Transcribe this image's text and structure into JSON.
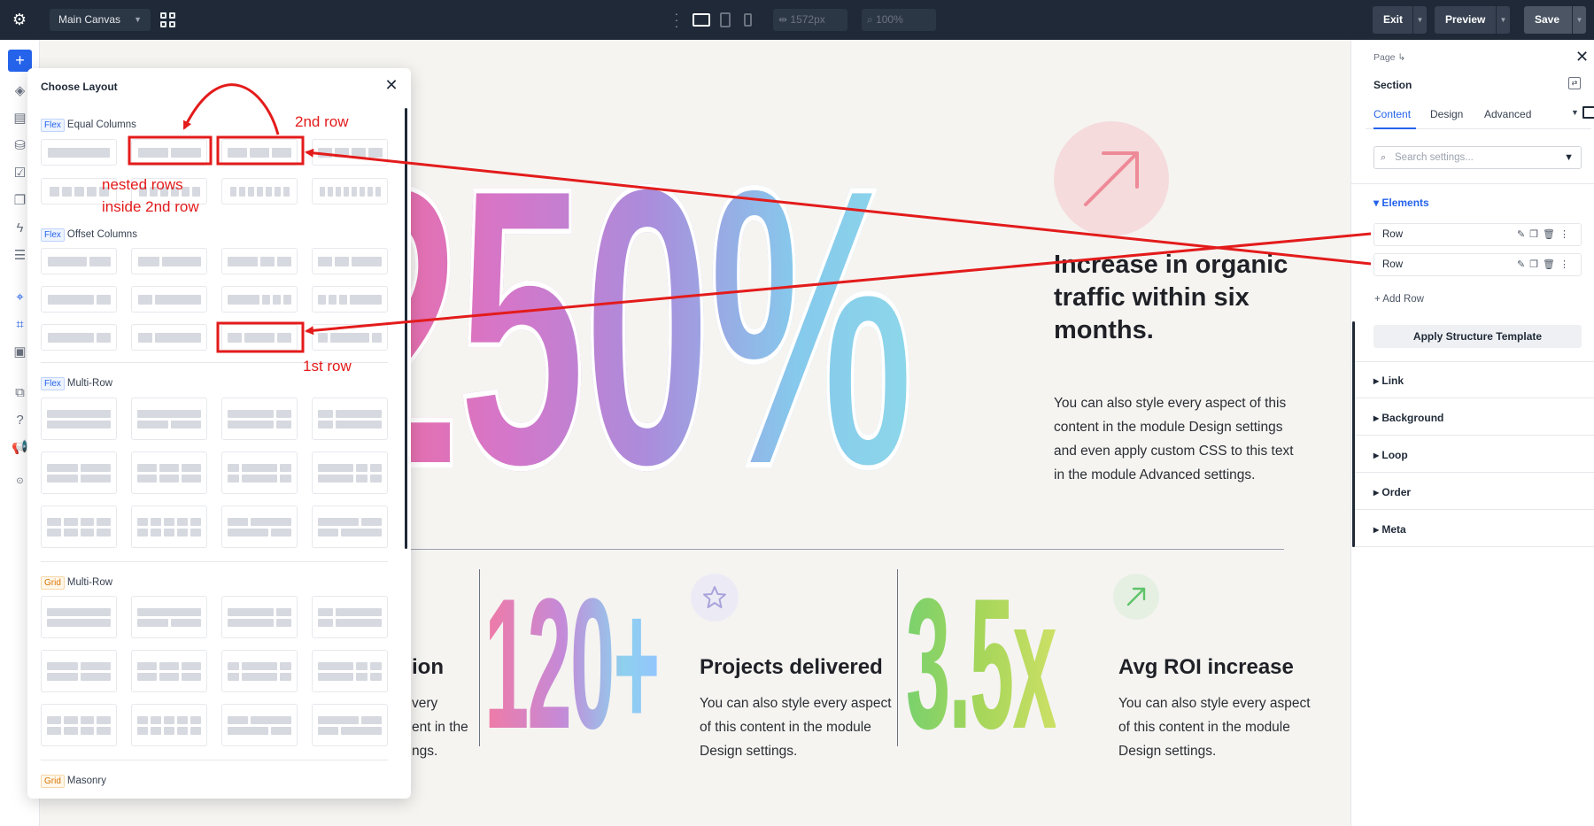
{
  "topbar": {
    "canvas_name": "Main Canvas",
    "width_value": "1572px",
    "zoom_value": "100%",
    "exit_label": "Exit",
    "preview_label": "Preview",
    "save_label": "Save"
  },
  "colors": {
    "topbar_bg": "#1f2937",
    "accent_blue": "#2563eb",
    "annotation_red": "#e31b1b",
    "canvas_bg": "#f5f4f1"
  },
  "modal": {
    "title": "Choose Layout",
    "sections": [
      {
        "tag": "Flex",
        "label": "Equal Columns"
      },
      {
        "tag": "Flex",
        "label": "Offset Columns"
      },
      {
        "tag": "Flex",
        "label": "Multi-Row"
      },
      {
        "tag": "Grid",
        "label": "Multi-Row"
      },
      {
        "tag": "Grid",
        "label": "Masonry"
      }
    ]
  },
  "annotations": {
    "second_row": "2nd row",
    "nested_rows_1": "nested rows",
    "nested_rows_2": "inside 2nd row",
    "first_row": "1st row"
  },
  "canvas": {
    "hero_number": "250%",
    "hero_title": "Increase in organic traffic within six months.",
    "hero_desc": "You can also style every aspect of this content in the module Design settings and even apply custom CSS to this text in the module Advanced settings.",
    "cut_title": "ion",
    "cut_desc_lines": [
      "very",
      "ent in the",
      "ngs."
    ],
    "stat1_number": "120+",
    "stat1_title": "Projects delivered",
    "stat1_desc": "You can also style every aspect of this content in the module Design settings.",
    "stat2_number": "3.5x",
    "stat2_title": "Avg ROI increase",
    "stat2_desc": "You can also style every aspect of this content in the module Design settings."
  },
  "panel": {
    "breadcrumb": "Page",
    "section_title": "Section",
    "tabs": [
      "Content",
      "Design",
      "Advanced"
    ],
    "search_placeholder": "Search settings...",
    "elements_label": "Elements",
    "rows": [
      "Row",
      "Row"
    ],
    "add_row_label": "Add Row",
    "apply_template_label": "Apply Structure Template",
    "accordions": [
      "Link",
      "Background",
      "Loop",
      "Order",
      "Meta"
    ]
  }
}
